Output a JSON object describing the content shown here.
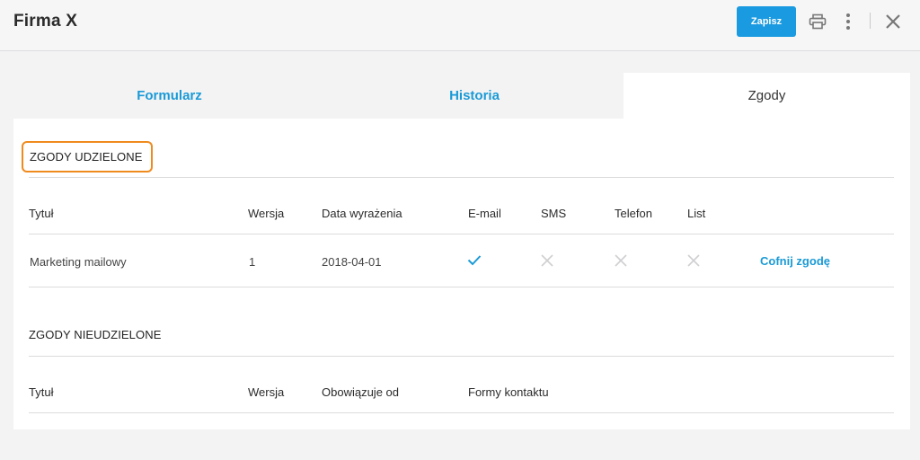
{
  "header": {
    "title": "Firma X",
    "save_label": "Zapisz",
    "icons": [
      "print-icon",
      "more-vertical-icon",
      "close-icon"
    ]
  },
  "tabs": [
    {
      "label": "Formularz",
      "active": false
    },
    {
      "label": "Historia",
      "active": false
    },
    {
      "label": "Zgody",
      "active": true
    }
  ],
  "granted": {
    "title": "ZGODY UDZIELONE",
    "columns": [
      "Tytuł",
      "Wersja",
      "Data wyrażenia",
      "E-mail",
      "SMS",
      "Telefon",
      "List"
    ],
    "rows": [
      {
        "title": "Marketing mailowy",
        "version": "1",
        "date": "2018-04-01",
        "email": "check-icon",
        "sms": "cross-icon",
        "phone": "cross-icon",
        "letter": "cross-icon",
        "action": "Cofnij zgodę"
      }
    ]
  },
  "not_granted": {
    "title": "ZGODY NIEUDZIELONE",
    "columns": [
      "Tytuł",
      "Wersja",
      "Obowiązuje od",
      "Formy kontaktu"
    ]
  },
  "colors": {
    "accent": "#1a9ad6",
    "button": "#1a9ae0",
    "highlight": "#ef8a1e"
  }
}
